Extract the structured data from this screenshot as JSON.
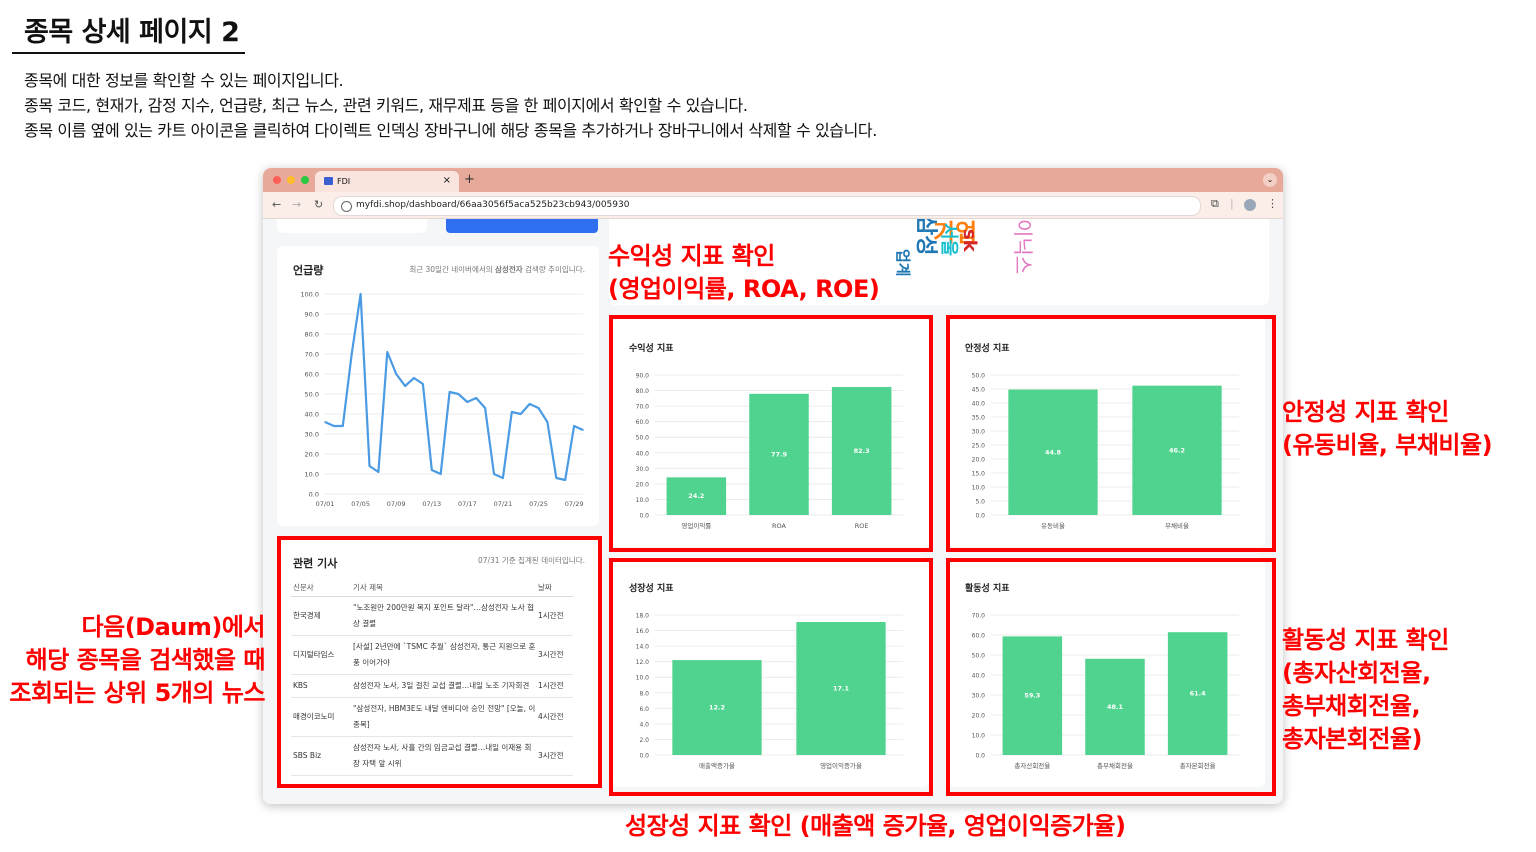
{
  "page": {
    "title": "종목 상세 페이지 2",
    "description": [
      "종목에 대한 정보를 확인할 수 있는 페이지입니다.",
      "종목 코드, 현재가, 감정 지수, 언급량, 최근 뉴스, 관련 키워드, 재무제표 등을 한 페이지에서 확인할 수 있습니다.",
      "종목 이름 옆에 있는 카트 아이콘을 클릭하여 다이렉트 인덱싱 장바구니에 해당 종목을 추가하거나 장바구니에서 삭제할 수 있습니다."
    ]
  },
  "browser": {
    "tab_title": "FDI",
    "url": "myfdi.shop/dashboard/66aa3056f5aca525b23cb943/005930"
  },
  "mentions": {
    "title": "언급량",
    "subtitle_prefix": "최근 30일간 네이버에서의 ",
    "subtitle_bold": "삼성전자",
    "subtitle_suffix": " 검색량 추이입니다.",
    "chart_data": {
      "type": "line",
      "x": [
        "07/01",
        "07/02",
        "07/03",
        "07/04",
        "07/05",
        "07/06",
        "07/07",
        "07/08",
        "07/09",
        "07/10",
        "07/11",
        "07/12",
        "07/13",
        "07/14",
        "07/15",
        "07/16",
        "07/17",
        "07/18",
        "07/19",
        "07/20",
        "07/21",
        "07/22",
        "07/23",
        "07/24",
        "07/25",
        "07/26",
        "07/27",
        "07/28",
        "07/29",
        "07/30"
      ],
      "y": [
        36,
        34,
        34,
        70,
        100,
        14,
        11,
        71,
        60,
        54,
        58,
        55,
        12,
        10,
        51,
        50,
        46,
        48,
        43,
        10,
        8,
        41,
        40,
        45,
        43,
        36,
        8,
        7,
        34,
        32
      ],
      "xticks": [
        "07/01",
        "07/05",
        "07/09",
        "07/13",
        "07/17",
        "07/21",
        "07/25",
        "07/29"
      ],
      "yticks": [
        "0.0",
        "10.0",
        "20.0",
        "30.0",
        "40.0",
        "50.0",
        "60.0",
        "70.0",
        "80.0",
        "90.0",
        "100.0"
      ],
      "ylim": [
        0,
        100
      ],
      "color": "#4a9be3"
    }
  },
  "news": {
    "title": "관련 기사",
    "note": "07/31 기준 집계된 데이터입니다.",
    "headers": {
      "source": "신문사",
      "headline": "기사 제목",
      "date": "날짜"
    },
    "rows": [
      {
        "source": "한국경제",
        "headline": "\"노조원만 200만원 복지 포인트 달라\"…삼성전자 노사 협상 결렬",
        "date": "1시간전"
      },
      {
        "source": "디지털타임스",
        "headline": "[사설] 2년만에 `TSMC 추월` 삼성전자, 통근 지원으로 훈풍 이어가야",
        "date": "3시간전"
      },
      {
        "source": "KBS",
        "headline": "삼성전자 노사, 3일 걸친 교섭 결렬…내일 노조 기자회견",
        "date": "1시간전"
      },
      {
        "source": "매경이코노미",
        "headline": "\"삼성전자, HBM3E도 내달 엔비디아 승인 전망\" [오늘, 이 종목]",
        "date": "4시간전"
      },
      {
        "source": "SBS Biz",
        "headline": "삼성전자 노사, 사흘 간의 임금교섭 결렬…내일 이재용 회장 자택 앞 시위",
        "date": "3시간전"
      }
    ]
  },
  "wordcloud": {
    "words": [
      {
        "text": "삼성",
        "color": "#1f77b4"
      },
      {
        "text": "기업",
        "color": "#ff7f0e"
      },
      {
        "text": "서울",
        "color": "#17becf"
      },
      {
        "text": "sk",
        "color": "#d62728"
      },
      {
        "text": "이닉스",
        "color": "#e377c2"
      },
      {
        "text": "업계",
        "color": "#1f77b4"
      }
    ]
  },
  "charts": {
    "profitability": {
      "title": "수익성 지표",
      "chart_data": {
        "type": "bar",
        "categories": [
          "영업이익률",
          "ROA",
          "ROE"
        ],
        "values": [
          24.2,
          77.9,
          82.3
        ],
        "ylim": [
          0,
          90
        ],
        "yticks": [
          "0.0",
          "10.0",
          "20.0",
          "30.0",
          "40.0",
          "50.0",
          "60.0",
          "70.0",
          "80.0",
          "90.0"
        ],
        "color": "#4fd38e"
      }
    },
    "stability": {
      "title": "안정성 지표",
      "chart_data": {
        "type": "bar",
        "categories": [
          "유동비율",
          "부채비율"
        ],
        "values": [
          44.8,
          46.2
        ],
        "ylim": [
          0,
          50
        ],
        "yticks": [
          "0.0",
          "5.0",
          "10.0",
          "15.0",
          "20.0",
          "25.0",
          "30.0",
          "35.0",
          "40.0",
          "45.0",
          "50.0"
        ],
        "color": "#4fd38e"
      }
    },
    "growth": {
      "title": "성장성 지표",
      "chart_data": {
        "type": "bar",
        "categories": [
          "매출액증가율",
          "영업이익증가율"
        ],
        "values": [
          12.2,
          17.1
        ],
        "ylim": [
          0,
          18
        ],
        "yticks": [
          "0.0",
          "2.0",
          "4.0",
          "6.0",
          "8.0",
          "10.0",
          "12.0",
          "14.0",
          "16.0",
          "18.0"
        ],
        "color": "#4fd38e"
      }
    },
    "activity": {
      "title": "활동성 지표",
      "chart_data": {
        "type": "bar",
        "categories": [
          "총자산회전율",
          "총부채회전율",
          "총자본회전율"
        ],
        "values": [
          59.3,
          48.1,
          61.4
        ],
        "ylim": [
          0,
          70
        ],
        "yticks": [
          "0.0",
          "10.0",
          "20.0",
          "30.0",
          "40.0",
          "50.0",
          "60.0",
          "70.0"
        ],
        "color": "#4fd38e"
      }
    }
  },
  "annotations": {
    "profitability": [
      "수익성 지표 확인",
      "(영업이익률, ROA, ROE)"
    ],
    "stability": [
      "안정성 지표 확인",
      "(유동비율, 부채비율)"
    ],
    "activity": [
      "활동성 지표 확인",
      "(총자산회전율,",
      "총부채회전율,",
      "총자본회전율)"
    ],
    "growth": "성장성 지표 확인 (매출액 증가율, 영업이익증가율)",
    "news": [
      "다음(Daum)에서",
      "해당 종목을 검색했을 때",
      "조회되는 상위 5개의 뉴스"
    ]
  }
}
